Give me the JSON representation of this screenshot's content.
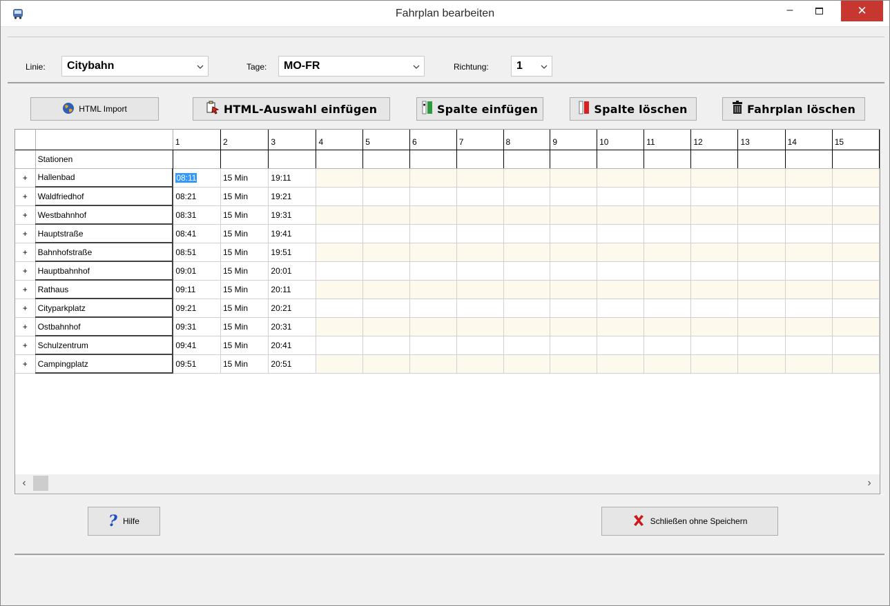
{
  "window": {
    "title": "Fahrplan bearbeiten",
    "minimize": "–",
    "close": "✕"
  },
  "filters": {
    "linie_label": "Linie:",
    "linie_value": "Citybahn",
    "tage_label": "Tage:",
    "tage_value": "MO-FR",
    "richtung_label": "Richtung:",
    "richtung_value": "1"
  },
  "toolbar": {
    "html_import": "HTML Import",
    "html_auswahl_einfuegen": "HTML-Auswahl einfügen",
    "spalte_einfuegen": "Spalte einfügen",
    "spalte_loeschen": "Spalte löschen",
    "fahrplan_loeschen": "Fahrplan löschen"
  },
  "grid": {
    "column_numbers": [
      "1",
      "2",
      "3",
      "4",
      "5",
      "6",
      "7",
      "8",
      "9",
      "10",
      "11",
      "12",
      "13",
      "14",
      "15"
    ],
    "stations_header": "Stationen",
    "expand_symbol": "+",
    "rows": [
      {
        "station": "Hallenbad",
        "c1": "08:11",
        "c2": "15 Min",
        "c3": "19:11"
      },
      {
        "station": "Waldfriedhof",
        "c1": "08:21",
        "c2": "15 Min",
        "c3": "19:21"
      },
      {
        "station": "Westbahnhof",
        "c1": "08:31",
        "c2": "15 Min",
        "c3": "19:31"
      },
      {
        "station": "Hauptstraße",
        "c1": "08:41",
        "c2": "15 Min",
        "c3": "19:41"
      },
      {
        "station": "Bahnhofstraße",
        "c1": "08:51",
        "c2": "15 Min",
        "c3": "19:51"
      },
      {
        "station": "Hauptbahnhof",
        "c1": "09:01",
        "c2": "15 Min",
        "c3": "20:01"
      },
      {
        "station": "Rathaus",
        "c1": "09:11",
        "c2": "15 Min",
        "c3": "20:11"
      },
      {
        "station": "Cityparkplatz",
        "c1": "09:21",
        "c2": "15 Min",
        "c3": "20:21"
      },
      {
        "station": "Ostbahnhof",
        "c1": "09:31",
        "c2": "15 Min",
        "c3": "20:31"
      },
      {
        "station": "Schulzentrum",
        "c1": "09:41",
        "c2": "15 Min",
        "c3": "20:41"
      },
      {
        "station": "Campingplatz",
        "c1": "09:51",
        "c2": "15 Min",
        "c3": "20:51"
      }
    ]
  },
  "bottom": {
    "hilfe": "Hilfe",
    "schliessen": "Schließen ohne Speichern"
  },
  "colors": {
    "cell_tint": "#fdf9ed",
    "selection": "#3399ff",
    "close_button": "#c7372f"
  }
}
